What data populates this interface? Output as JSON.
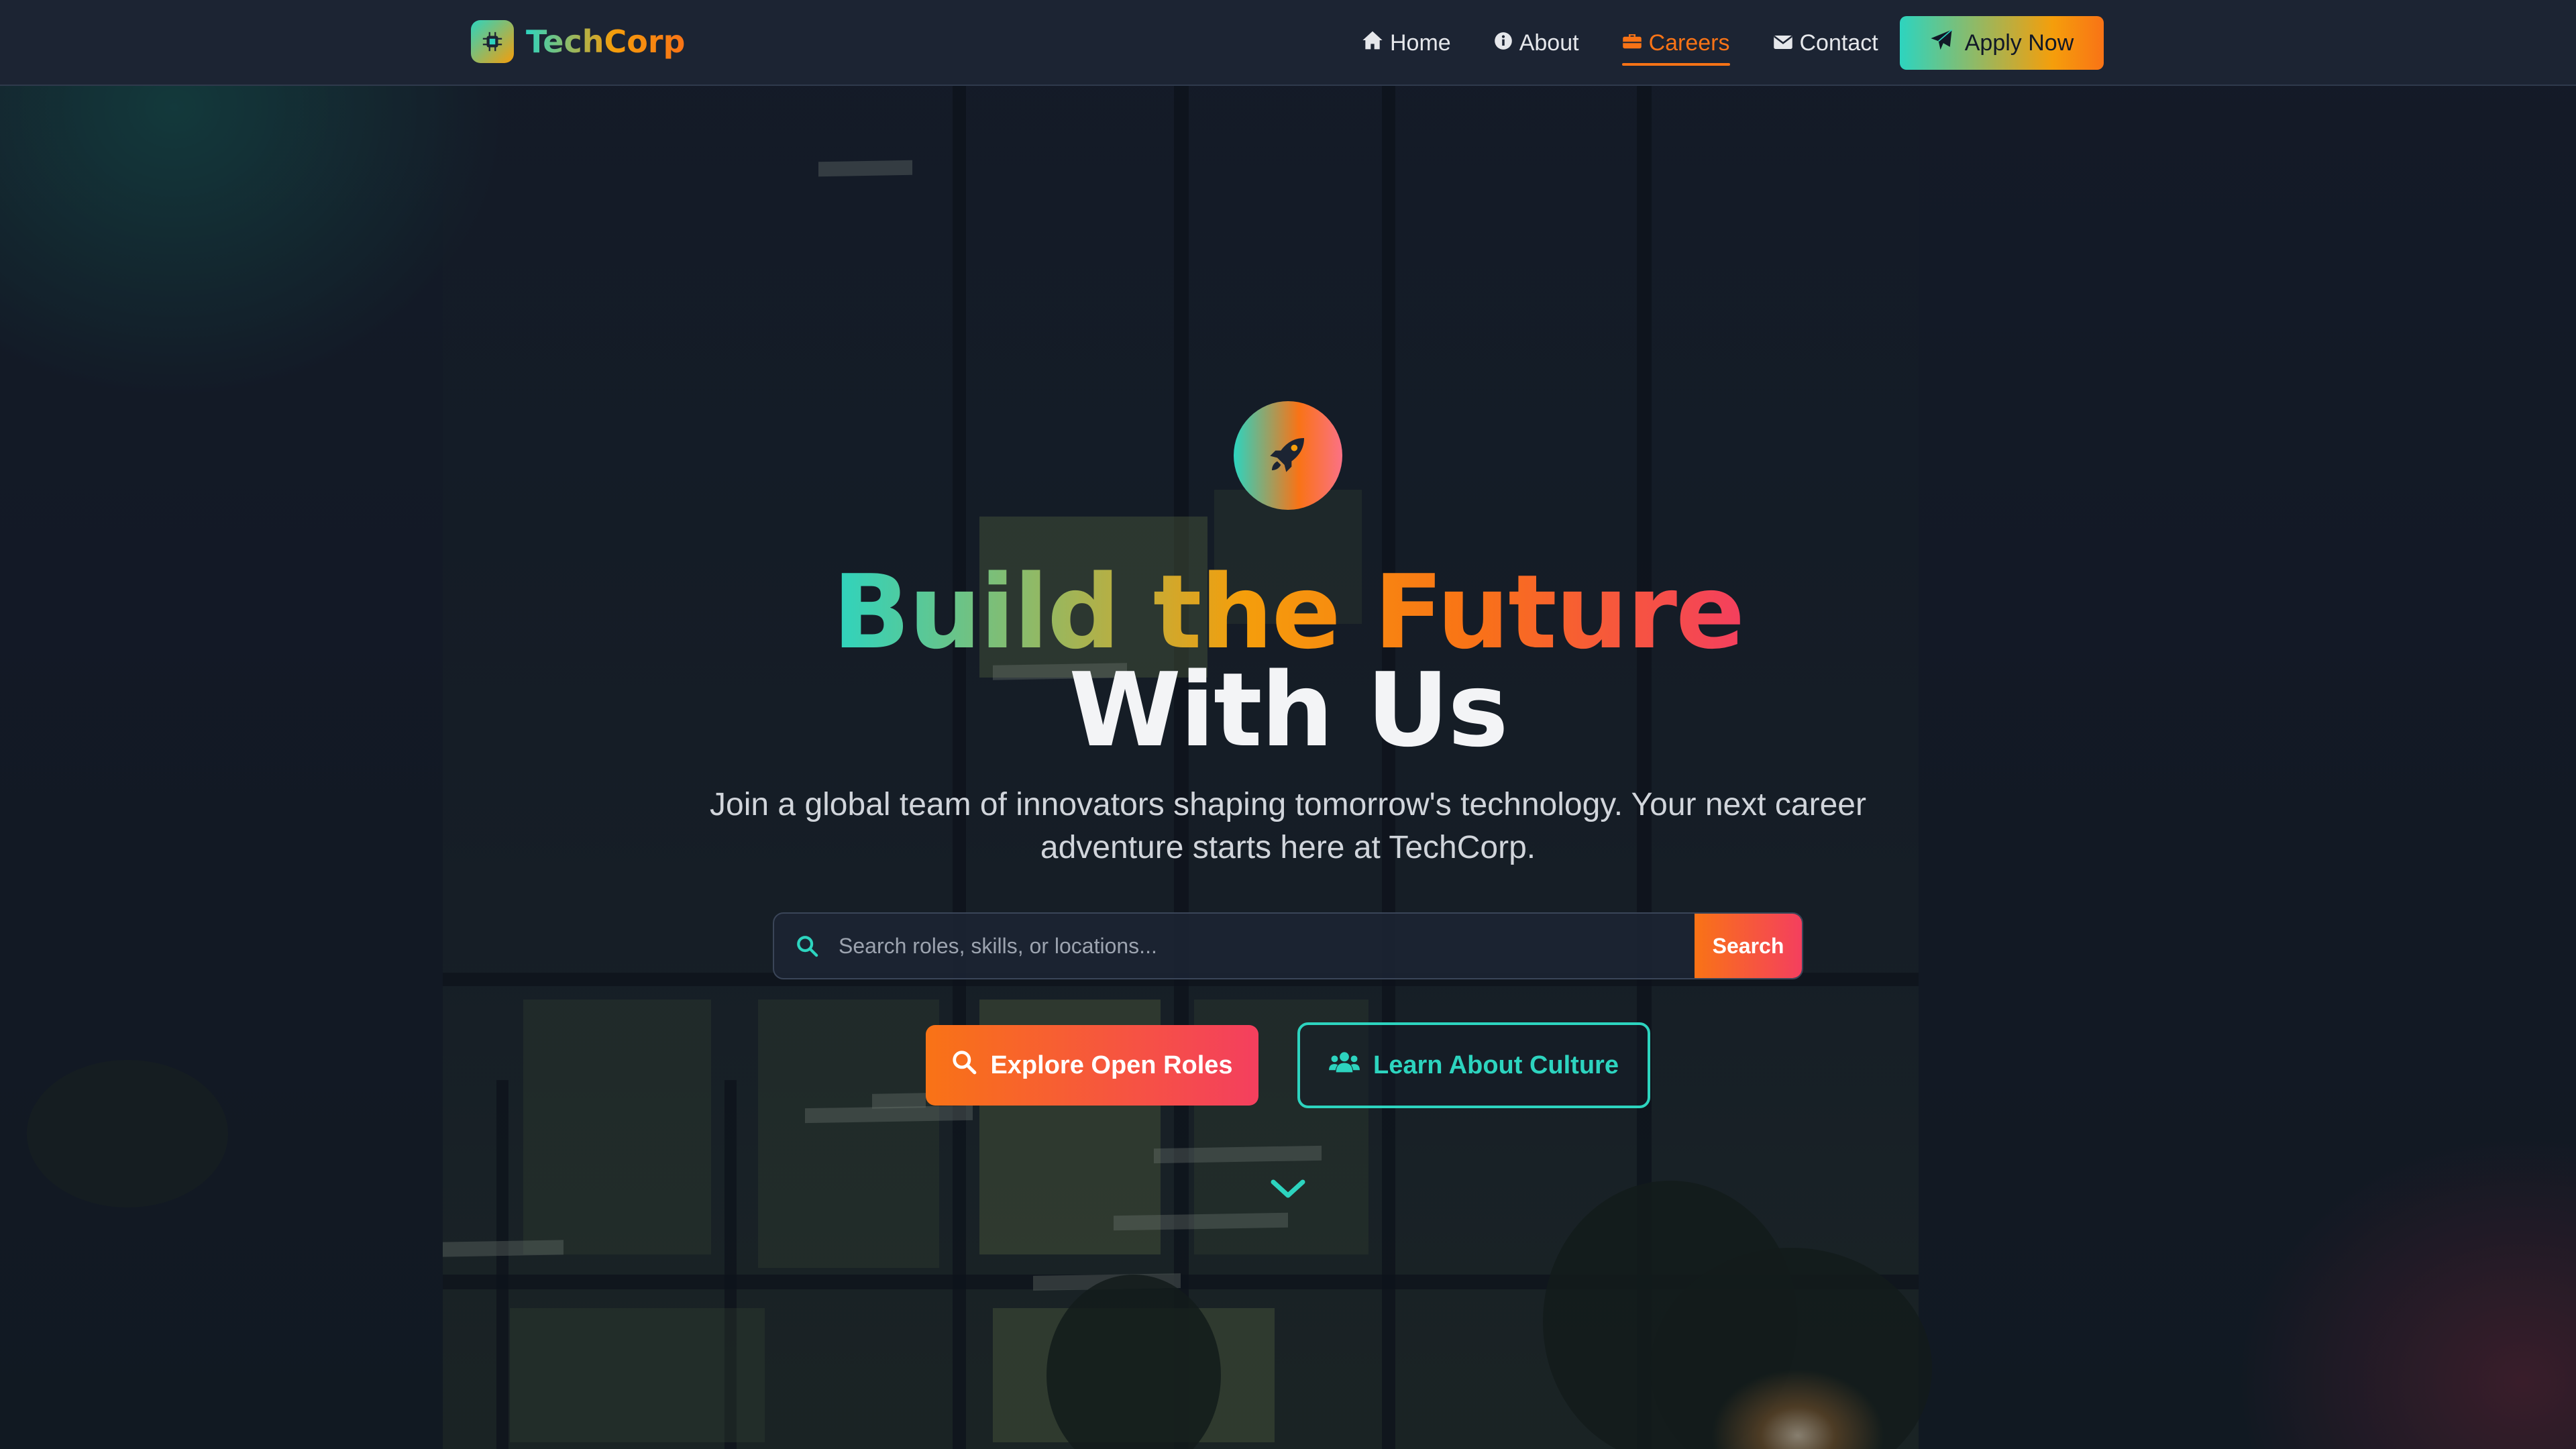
{
  "nav": {
    "brand": "TechCorp",
    "items": [
      {
        "label": "Home",
        "icon": "home-icon",
        "active": false
      },
      {
        "label": "About",
        "icon": "info-icon",
        "active": false
      },
      {
        "label": "Careers",
        "icon": "briefcase-icon",
        "active": true
      },
      {
        "label": "Contact",
        "icon": "envelope-icon",
        "active": false
      }
    ],
    "apply_label": "Apply Now"
  },
  "hero": {
    "headline_line1": "Build the Future",
    "headline_line2": "With Us",
    "subtitle": "Join a global team of innovators shaping tomorrow's technology. Your next career adventure starts here at TechCorp.",
    "search": {
      "placeholder": "Search roles, skills, or locations...",
      "value": "",
      "button_label": "Search"
    },
    "primary_cta": "Explore Open Roles",
    "secondary_cta": "Learn About Culture"
  },
  "colors": {
    "accent_teal": "#2dd4bf",
    "accent_orange": "#f97316",
    "accent_pink": "#f43f5e",
    "nav_bg": "#1c2433",
    "page_bg": "#141b29"
  }
}
